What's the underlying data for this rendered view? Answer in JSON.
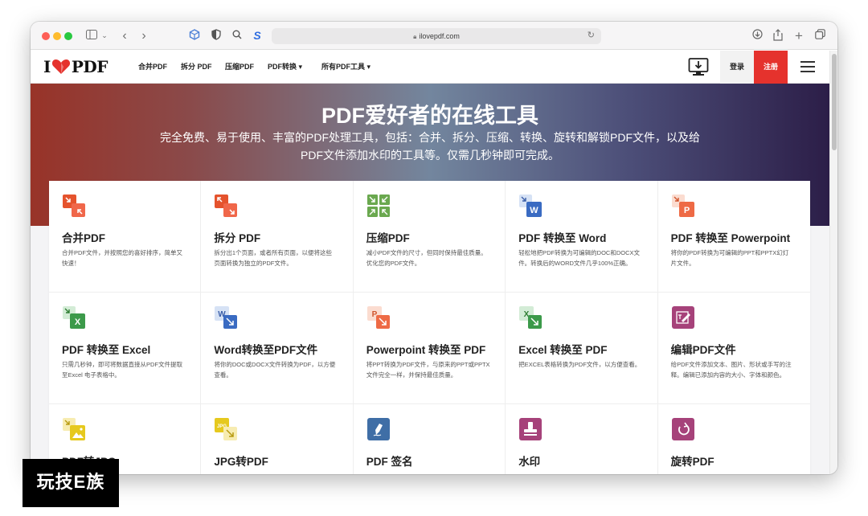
{
  "browser": {
    "url": "ilovepdf.com",
    "lock_icon": "lock-icon",
    "icons": [
      "sidebar-icon",
      "chevron-down-icon",
      "back-icon",
      "forward-icon",
      "extension-icon",
      "shield-icon",
      "search-icon",
      "extension-s-icon",
      "reload-icon",
      "download-icon",
      "share-icon",
      "new-tab-icon",
      "tabs-icon"
    ]
  },
  "site": {
    "logo_left": "I",
    "logo_right": "PDF",
    "nav": [
      "合并PDF",
      "拆分 PDF",
      "压缩PDF",
      "PDF转换",
      "所有PDF工具"
    ],
    "login": "登录",
    "signup": "注册",
    "brand_color": "#e5322d"
  },
  "hero": {
    "title": "PDF爱好者的在线工具",
    "subtitle": "完全免费、易于使用、丰富的PDF处理工具，包括：合并、拆分、压缩、转换、旋转和解锁PDF文件，以及给PDF文件添加水印的工具等。仅需几秒钟即可完成。"
  },
  "tools": [
    {
      "title": "合并PDF",
      "desc": "合并PDF文件，并按照您的喜好排序，简单又快速！",
      "icon": "merge-icon"
    },
    {
      "title": "拆分 PDF",
      "desc": "拆分出1个页面，或者所有页面，以便将这些页面转换为独立的PDF文件。",
      "icon": "split-icon"
    },
    {
      "title": "压缩PDF",
      "desc": "减小PDF文件的尺寸，但同时保持最佳质量。优化您的PDF文件。",
      "icon": "compress-icon"
    },
    {
      "title": "PDF 转换至 Word",
      "desc": "轻松地把PDF转换为可编辑的DOC和DOCX文件。转换后的WORD文件几乎100%正确。",
      "icon": "pdf-to-word-icon"
    },
    {
      "title": "PDF 转换至 Powerpoint",
      "desc": "将你的PDF转换为可编辑的PPT和PPTX幻灯片文件。",
      "icon": "pdf-to-powerpoint-icon"
    },
    {
      "title": "PDF 转换至 Excel",
      "desc": "只需几秒钟，即可将数据直接从PDF文件提取至Excel 电子表格中。",
      "icon": "pdf-to-excel-icon"
    },
    {
      "title": "Word转换至PDF文件",
      "desc": "将你的DOC或DOCX文件转换为PDF，以方便查看。",
      "icon": "word-to-pdf-icon"
    },
    {
      "title": "Powerpoint 转换至 PDF",
      "desc": "将PPT转换为PDF文件，与原来的PPT或PPTX文件完全一样，并保持最佳质量。",
      "icon": "powerpoint-to-pdf-icon"
    },
    {
      "title": "Excel 转换至 PDF",
      "desc": "把EXCEL表格转换为PDF文件，以方便查看。",
      "icon": "excel-to-pdf-icon"
    },
    {
      "title": "编辑PDF文件",
      "desc": "给PDF文件添加文本、图片、形状或手写的注释。编辑已添加内容的大小、字体和颜色。",
      "icon": "edit-pdf-icon"
    },
    {
      "title": "PDF转JPG",
      "desc": "",
      "icon": "pdf-to-jpg-icon"
    },
    {
      "title": "JPG转PDF",
      "desc": "",
      "icon": "jpg-to-pdf-icon"
    },
    {
      "title": "PDF 签名",
      "desc": "",
      "icon": "sign-pdf-icon"
    },
    {
      "title": "水印",
      "desc": "",
      "icon": "watermark-icon"
    },
    {
      "title": "旋转PDF",
      "desc": "",
      "icon": "rotate-pdf-icon"
    }
  ],
  "watermark_text": "玩技E族"
}
